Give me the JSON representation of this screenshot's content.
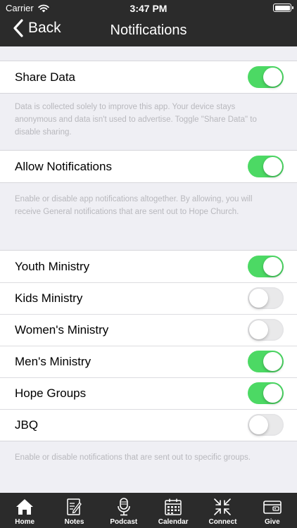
{
  "status_bar": {
    "carrier": "Carrier",
    "time": "3:47 PM"
  },
  "nav": {
    "back_label": "Back",
    "title": "Notifications"
  },
  "sections": [
    {
      "rows": [
        {
          "label": "Share Data",
          "on": true
        }
      ],
      "footer": "Data is collected solely to improve this app. Your device stays anonymous and data isn't used to advertise. Toggle \"Share Data\" to disable sharing."
    },
    {
      "rows": [
        {
          "label": "Allow Notifications",
          "on": true
        }
      ],
      "footer": "Enable or disable app notifications altogether. By allowing, you will receive General notifications that are sent out to Hope Church."
    },
    {
      "rows": [
        {
          "label": "Youth Ministry",
          "on": true
        },
        {
          "label": "Kids Ministry",
          "on": false
        },
        {
          "label": "Women's Ministry",
          "on": false
        },
        {
          "label": "Men's Ministry",
          "on": true
        },
        {
          "label": "Hope Groups",
          "on": true
        },
        {
          "label": "JBQ",
          "on": false
        }
      ],
      "footer": "Enable or disable notifications that are sent out to specific groups."
    }
  ],
  "tabs": [
    {
      "label": "Home",
      "icon": "home-icon"
    },
    {
      "label": "Notes",
      "icon": "notes-icon"
    },
    {
      "label": "Podcast",
      "icon": "microphone-icon"
    },
    {
      "label": "Calendar",
      "icon": "calendar-icon"
    },
    {
      "label": "Connect",
      "icon": "connect-arrows-icon"
    },
    {
      "label": "Give",
      "icon": "wallet-icon"
    }
  ],
  "colors": {
    "toggle_on": "#4cd964",
    "bar_bg": "#2b2b2b",
    "page_bg": "#efeff4"
  }
}
